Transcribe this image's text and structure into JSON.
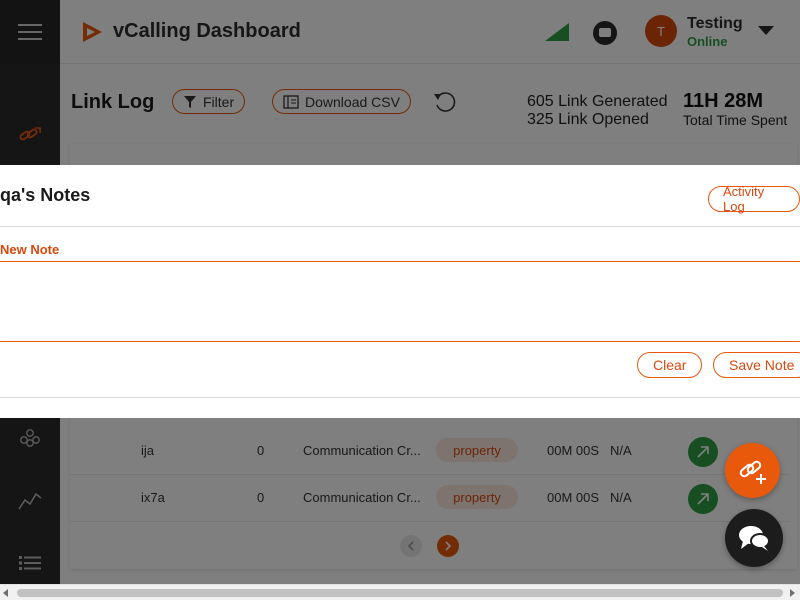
{
  "header": {
    "app_title": "vCalling Dashboard",
    "user": {
      "avatar_initial": "T",
      "name": "Testing",
      "status": "Online"
    }
  },
  "toolbar": {
    "page_title": "Link Log",
    "filter_label": "Filter",
    "csv_label": "Download CSV"
  },
  "stats": {
    "generated": "605 Link Generated",
    "opened": "325 Link Opened",
    "time_value": "11H 28M",
    "time_label": "Total Time Spent"
  },
  "table": {
    "rows": [
      {
        "name": "ija",
        "count": "0",
        "description": "Communication Cr...",
        "tag": "property",
        "duration": "00M 00S",
        "extra": "N/A"
      },
      {
        "name": "ix7a",
        "count": "0",
        "description": "Communication Cr...",
        "tag": "property",
        "duration": "00M 00S",
        "extra": "N/A"
      }
    ]
  },
  "modal": {
    "title": "qa's Notes",
    "activity_button": "Activity Log",
    "new_note_label": "New Note",
    "note_value": "",
    "clear_button": "Clear",
    "save_button": "Save Note"
  },
  "colors": {
    "accent": "#e8590c",
    "sidebar": "#2b2b2b",
    "online": "#2f9e44"
  },
  "icons": [
    "menu-icon",
    "link-icon",
    "users-icon",
    "analytics-icon",
    "list-icon",
    "logo-icon",
    "signal-icon",
    "chat-icon",
    "chevron-down-icon",
    "filter-icon",
    "document-icon",
    "refresh-icon",
    "share-link-icon",
    "add-link-icon",
    "support-chat-icon"
  ]
}
